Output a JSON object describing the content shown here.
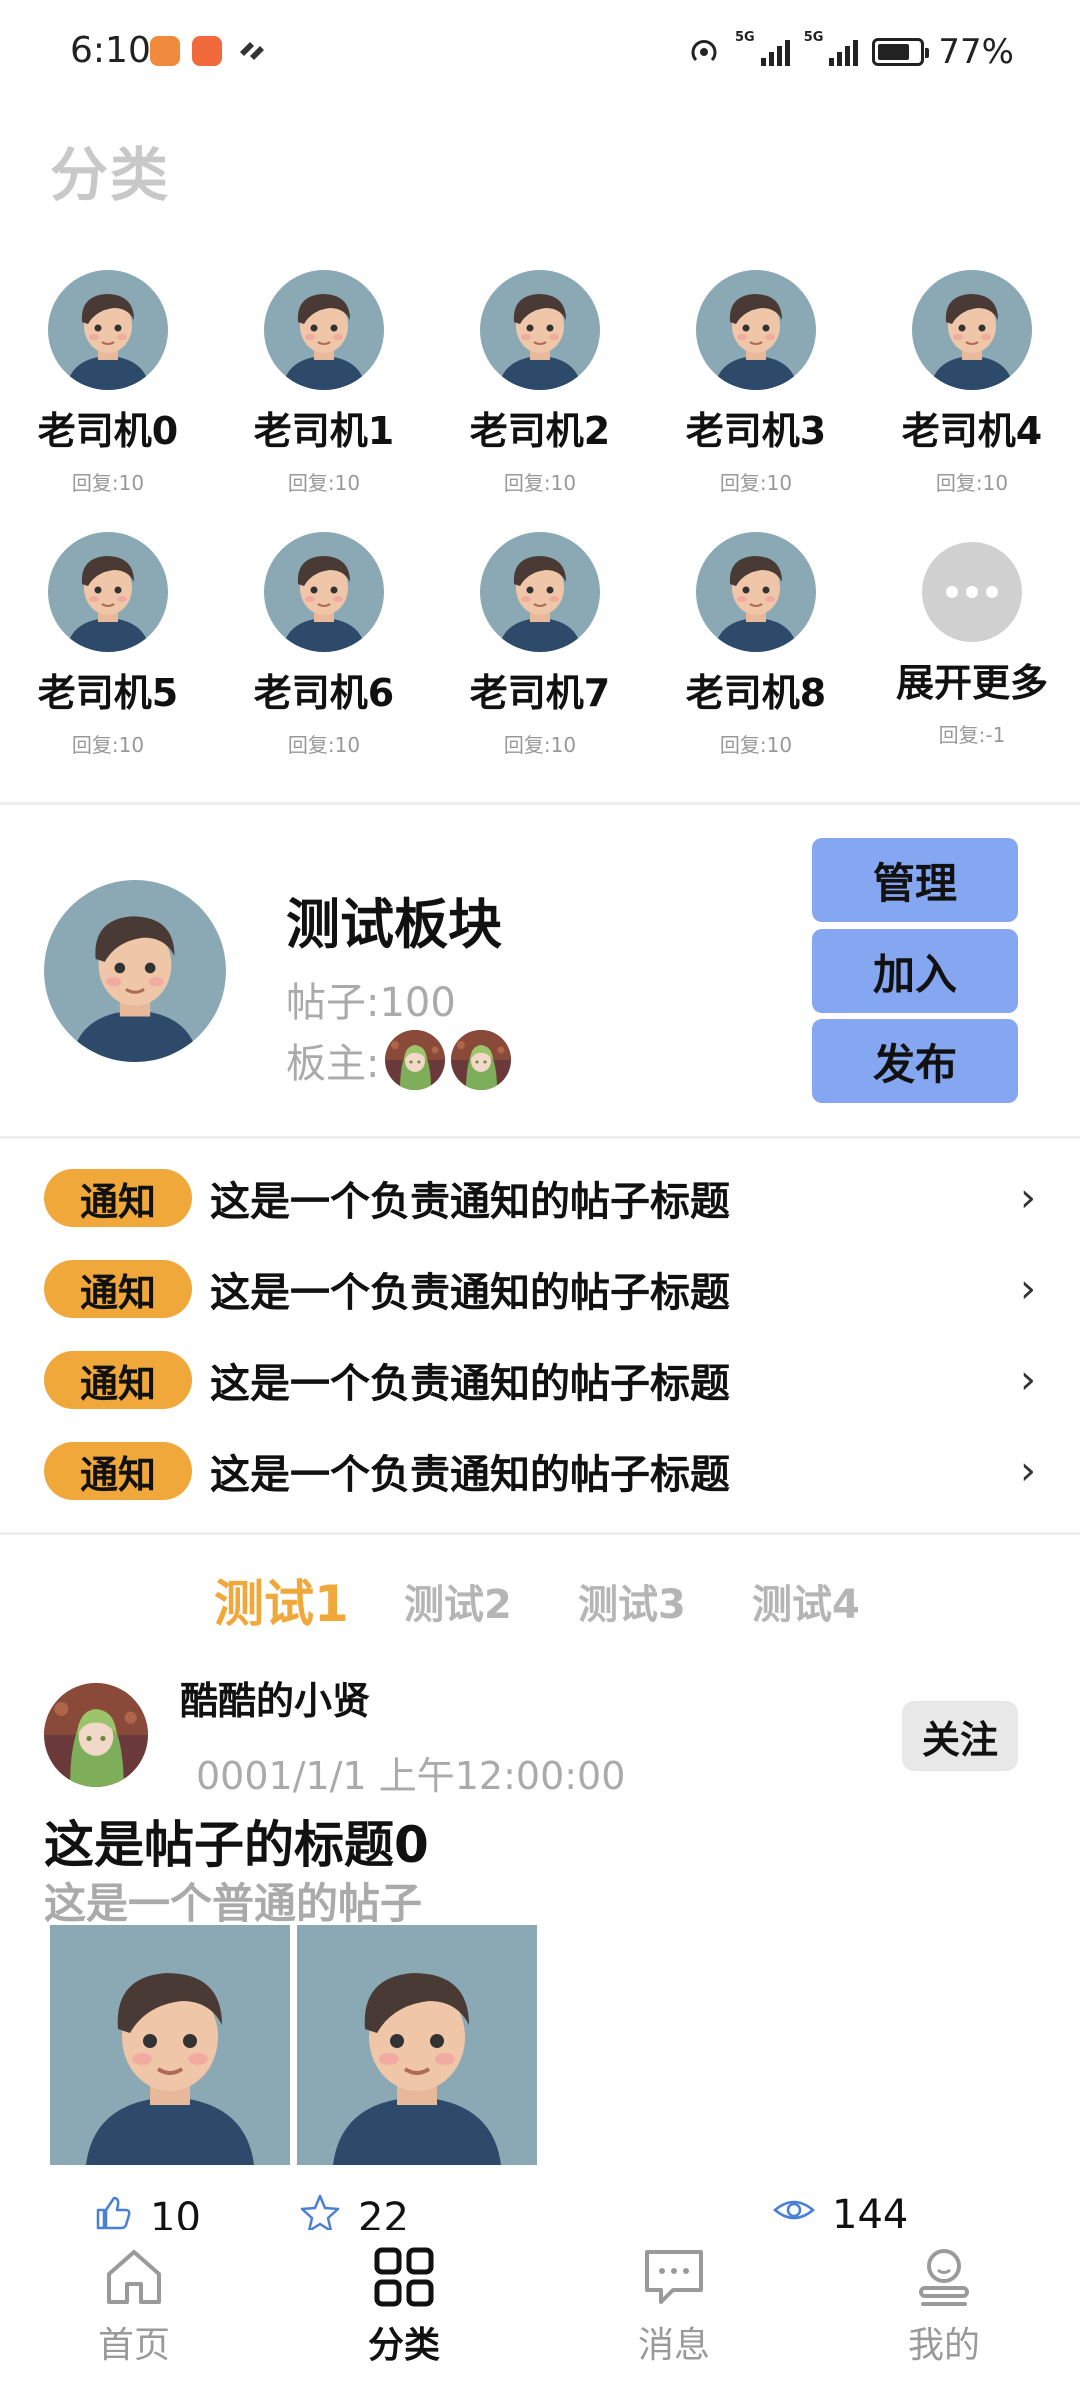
{
  "status_bar": {
    "time": "6:10",
    "battery_percent": "77%",
    "battery_level": 0.77,
    "network_label": "5G"
  },
  "header": {
    "title": "分类"
  },
  "categories": [
    {
      "name": "老司机0",
      "reply": "回复:10"
    },
    {
      "name": "老司机1",
      "reply": "回复:10"
    },
    {
      "name": "老司机2",
      "reply": "回复:10"
    },
    {
      "name": "老司机3",
      "reply": "回复:10"
    },
    {
      "name": "老司机4",
      "reply": "回复:10"
    },
    {
      "name": "老司机5",
      "reply": "回复:10"
    },
    {
      "name": "老司机6",
      "reply": "回复:10"
    },
    {
      "name": "老司机7",
      "reply": "回复:10"
    },
    {
      "name": "老司机8",
      "reply": "回复:10"
    }
  ],
  "more_item": {
    "name": "展开更多",
    "reply": "回复:-1"
  },
  "forum": {
    "name": "测试板块",
    "posts": "帖子:100",
    "moderators_label": "板主:",
    "buttons": {
      "manage": "管理",
      "join": "加入",
      "publish": "发布"
    }
  },
  "notices": [
    {
      "tag": "通知",
      "title": "这是一个负责通知的帖子标题"
    },
    {
      "tag": "通知",
      "title": "这是一个负责通知的帖子标题"
    },
    {
      "tag": "通知",
      "title": "这是一个负责通知的帖子标题"
    },
    {
      "tag": "通知",
      "title": "这是一个负责通知的帖子标题"
    }
  ],
  "tabs": [
    {
      "label": "测试1",
      "active": true
    },
    {
      "label": "测试2",
      "active": false
    },
    {
      "label": "测试3",
      "active": false
    },
    {
      "label": "测试4",
      "active": false
    }
  ],
  "post": {
    "author": "酷酷的小贤",
    "time": "0001/1/1 上午12:00:00",
    "follow_label": "关注",
    "title": "这是帖子的标题0",
    "description": "这是一个普通的帖子",
    "likes": "10",
    "favorites": "22",
    "views": "144"
  },
  "bottom_nav": [
    {
      "label": "首页",
      "icon": "home-icon",
      "active": false
    },
    {
      "label": "分类",
      "icon": "grid-icon",
      "active": true
    },
    {
      "label": "消息",
      "icon": "message-icon",
      "active": false
    },
    {
      "label": "我的",
      "icon": "user-icon",
      "active": false
    }
  ],
  "colors": {
    "accent": "#f0a83a",
    "button_blue": "#85a7f2",
    "avatar_bg": "#8aa9b4",
    "stat_icon_blue": "#4a7fd6"
  }
}
